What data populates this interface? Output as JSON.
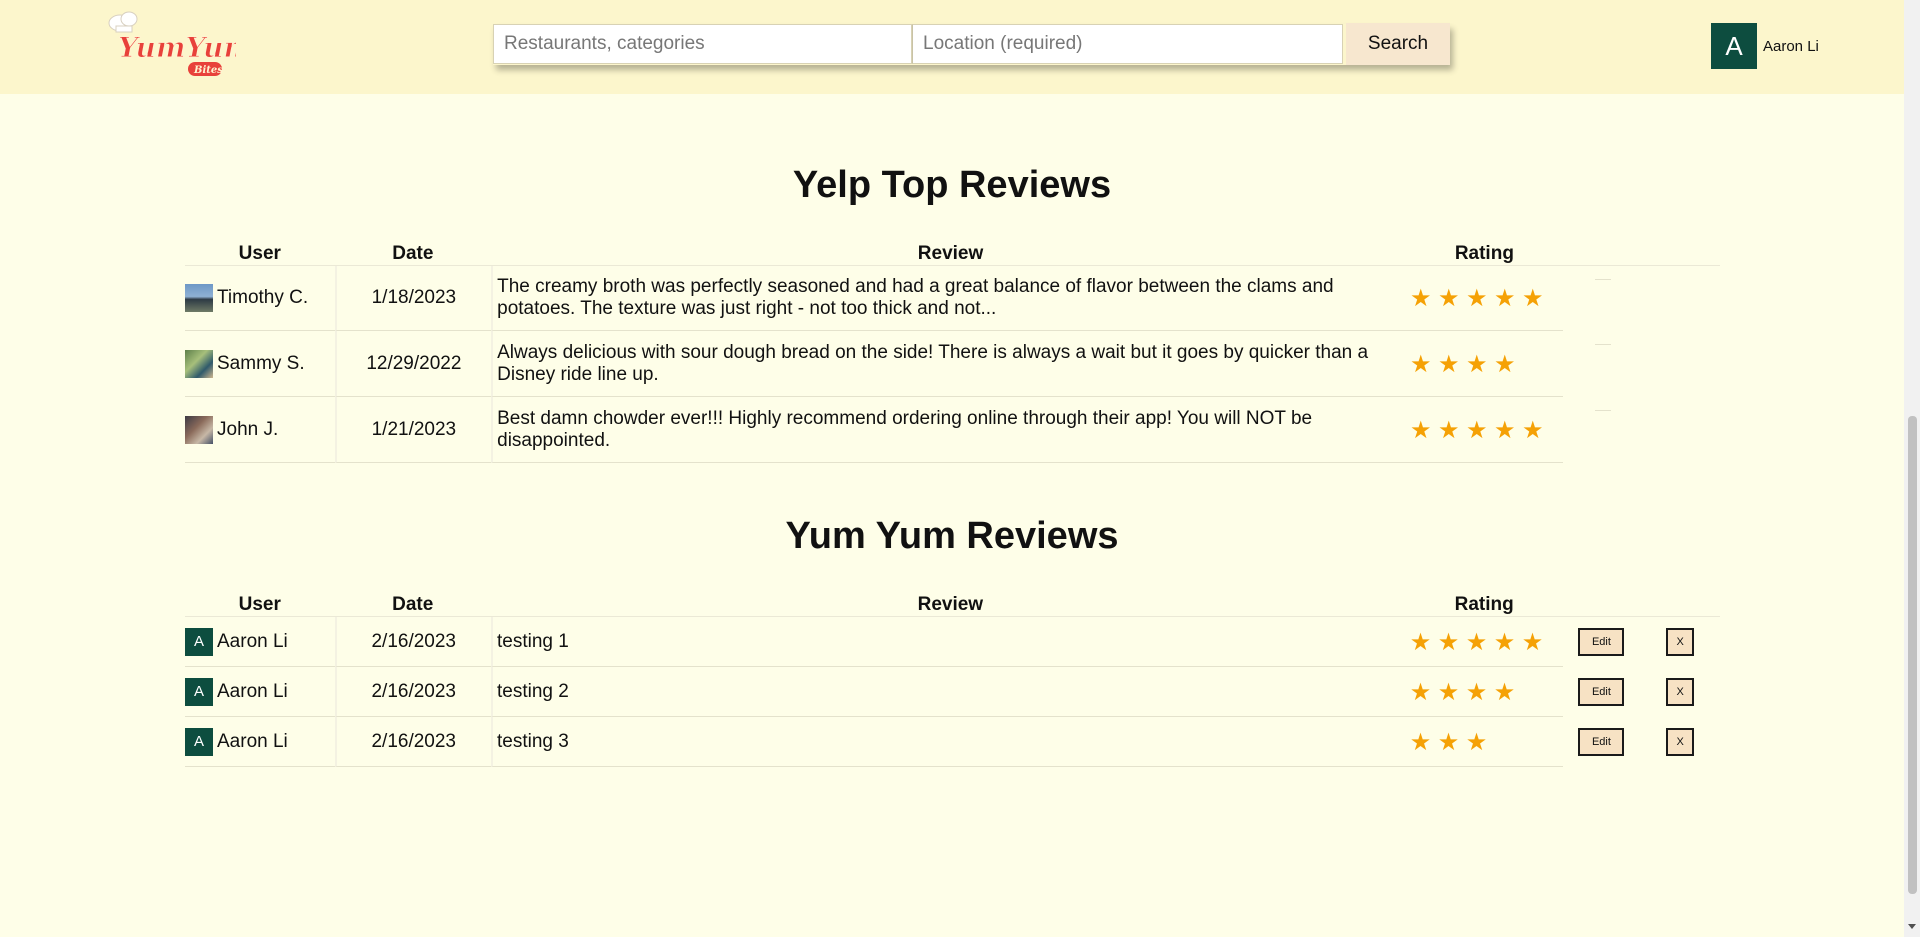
{
  "header": {
    "logo_text": "YumYum Bites",
    "search_placeholder": "Restaurants, categories",
    "location_placeholder": "Location (required)",
    "search_label": "Search",
    "user_initial": "A",
    "user_name": "Aaron Li"
  },
  "yelp": {
    "title": "Yelp Top Reviews",
    "columns": [
      "User",
      "Date",
      "Review",
      "Rating"
    ],
    "rows": [
      {
        "user": "Timothy C.",
        "date": "1/18/2023",
        "review": "The creamy broth was perfectly seasoned and had a great balance of flavor between the clams and potatoes. The texture was just right - not too thick and not...",
        "rating": 5
      },
      {
        "user": "Sammy S.",
        "date": "12/29/2022",
        "review": "Always delicious with sour dough bread on the side! There is always a wait but it goes by quicker than a Disney ride line up.",
        "rating": 4
      },
      {
        "user": "John J.",
        "date": "1/21/2023",
        "review": "Best damn chowder ever!!! Highly recommend ordering online through their app! You will NOT be disappointed.",
        "rating": 5
      }
    ]
  },
  "yumyum": {
    "title": "Yum Yum Reviews",
    "columns": [
      "User",
      "Date",
      "Review",
      "Rating"
    ],
    "edit_label": "Edit",
    "delete_label": "X",
    "rows": [
      {
        "initial": "A",
        "user": "Aaron Li",
        "date": "2/16/2023",
        "review": "testing 1",
        "rating": 5
      },
      {
        "initial": "A",
        "user": "Aaron Li",
        "date": "2/16/2023",
        "review": "testing 2",
        "rating": 4
      },
      {
        "initial": "A",
        "user": "Aaron Li",
        "date": "2/16/2023",
        "review": "testing 3",
        "rating": 3
      }
    ]
  },
  "colors": {
    "header_bg": "#fcf6cc",
    "page_bg": "#fefee8",
    "avatar_bg": "#0d4d3f",
    "star": "#f5a105",
    "button_bg": "#f7e7cf"
  }
}
